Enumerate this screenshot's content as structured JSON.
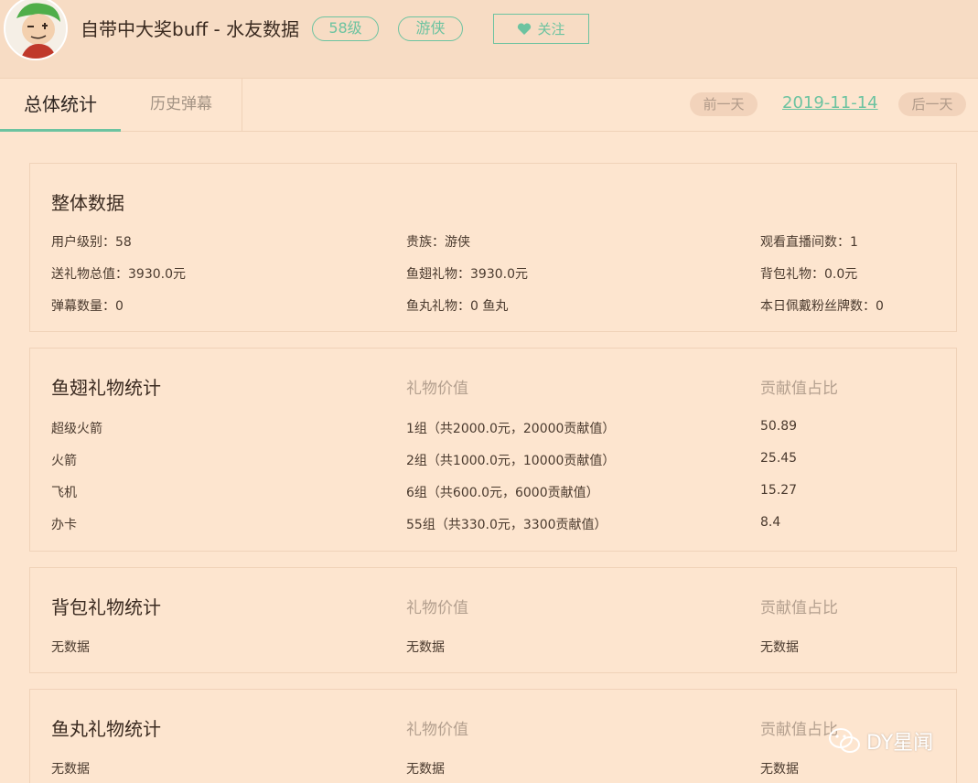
{
  "header": {
    "title": "自带中大奖buff - 水友数据",
    "level_pill": "58级",
    "noble_pill": "游侠",
    "follow_label": "关注"
  },
  "tabs": [
    {
      "label": "总体统计",
      "active": true
    },
    {
      "label": "历史弹幕",
      "active": false
    }
  ],
  "date_nav": {
    "prev_label": "前一天",
    "date": "2019-11-14",
    "next_label": "后一天"
  },
  "overall": {
    "title": "整体数据",
    "rows": [
      [
        "用户级别：58",
        "贵族：游侠",
        "观看直播间数：1"
      ],
      [
        "送礼物总值：3930.0元",
        "鱼翅礼物：3930.0元",
        "背包礼物：0.0元"
      ],
      [
        "弹幕数量：0",
        "鱼丸礼物：0 鱼丸",
        "本日佩戴粉丝牌数：0"
      ]
    ]
  },
  "fish_fin": {
    "title": "鱼翅礼物统计",
    "col2": "礼物价值",
    "col3": "贡献值占比",
    "rows": [
      [
        "超级火箭",
        "1组（共2000.0元，20000贡献值）",
        "50.89"
      ],
      [
        "火箭",
        "2组（共1000.0元，10000贡献值）",
        "25.45"
      ],
      [
        "飞机",
        "6组（共600.0元，6000贡献值）",
        "15.27"
      ],
      [
        "办卡",
        "55组（共330.0元，3300贡献值）",
        "8.4"
      ]
    ]
  },
  "backpack": {
    "title": "背包礼物统计",
    "col2": "礼物价值",
    "col3": "贡献值占比",
    "rows": [
      [
        "无数据",
        "无数据",
        "无数据"
      ]
    ]
  },
  "fish_ball": {
    "title": "鱼丸礼物统计",
    "col2": "礼物价值",
    "col3": "贡献值占比",
    "rows": [
      [
        "无数据",
        "无数据",
        "无数据"
      ]
    ]
  },
  "watermark": "DY星闻",
  "colors": {
    "accent": "#6cc3a0",
    "background": "#fde5cf",
    "header_bg": "#f7dcc4"
  },
  "icons": {
    "follow": "heart-icon",
    "watermark": "wechat-icon"
  }
}
